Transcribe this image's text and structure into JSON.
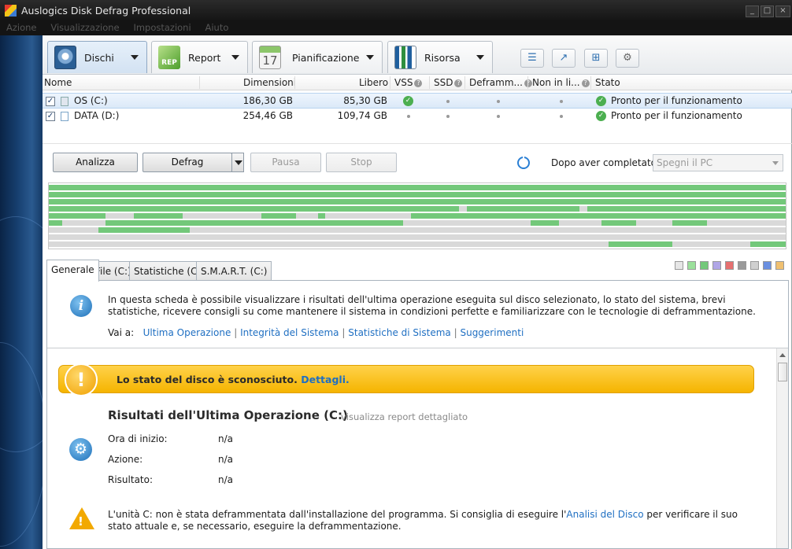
{
  "window": {
    "title": "Auslogics Disk Defrag Professional",
    "controls": [
      "_",
      "□",
      "×"
    ]
  },
  "menu": [
    "Azione",
    "Visualizzazione",
    "Impostazioni",
    "Aiuto"
  ],
  "toolbar": {
    "tabs": [
      {
        "label": "Dischi",
        "icon": "disk-icon"
      },
      {
        "label": "Report",
        "icon": "report-icon"
      },
      {
        "label": "Pianificazione",
        "icon": "calendar-icon",
        "calendar_day": "17"
      },
      {
        "label": "Risorsa",
        "icon": "chart-icon"
      }
    ],
    "icon_buttons": [
      "list-icon",
      "trend-icon",
      "windows-icon",
      "settings-icon"
    ]
  },
  "columns": {
    "nome": "Nome",
    "dimensioni": "Dimensioni",
    "libero": "Libero",
    "vss": "VSS",
    "ssd": "SSD",
    "deframm": "Deframm...",
    "non_in_li": "Non in li...",
    "stato": "Stato"
  },
  "drives": [
    {
      "checked": true,
      "name": "OS (C:)",
      "size": "186,30 GB",
      "free": "85,30 GB",
      "vss": true,
      "status": "Pronto per il funzionamento",
      "selected": true
    },
    {
      "checked": true,
      "name": "DATA (D:)",
      "size": "254,46 GB",
      "free": "109,74 GB",
      "vss": false,
      "status": "Pronto per il funzionamento",
      "selected": false
    }
  ],
  "actions": {
    "analizza": "Analizza",
    "defrag": "Defrag",
    "pausa": "Pausa",
    "stop": "Stop",
    "after_label": "Dopo aver completato:",
    "after_value": "Spegni il PC",
    "after_checked": false
  },
  "cluster_colors": {
    "used": "#73c87a",
    "free": "#d9d9d9"
  },
  "tabs": [
    "Generale",
    "File (C:)",
    "Statistiche (C:)",
    "S.M.A.R.T. (C:)"
  ],
  "legend_colors": [
    "#e6e6e6",
    "#9be09b",
    "#73c87a",
    "#b0a6e6",
    "#e67070",
    "#9a9a9a",
    "#cfcfcf",
    "#6a8fe0",
    "#f0c070"
  ],
  "info": {
    "text": "In questa scheda è possibile visualizzare i risultati dell'ultima operazione eseguita sul disco selezionato, lo stato del sistema, brevi statistiche, ricevere consigli su come mantenere il sistema in condizioni perfette e familiarizzare con le tecnologie di deframmentazione.",
    "vai_label": "Vai a:",
    "links": [
      "Ultima Operazione",
      "Integrità del Sistema",
      "Statistiche di Sistema",
      "Suggerimenti"
    ]
  },
  "warning": {
    "text": "Lo stato del disco è sconosciuto.",
    "link": "Dettagli."
  },
  "results": {
    "title": "Risultati dell'Ultima Operazione (C:)",
    "report_link": "visualizza report dettagliato",
    "rows": [
      {
        "label": "Ora di inizio:",
        "value": "n/a"
      },
      {
        "label": "Azione:",
        "value": "n/a"
      },
      {
        "label": "Risultato:",
        "value": "n/a"
      }
    ]
  },
  "note": {
    "pre": "L'unità C: non è stata deframmentata dall'installazione del programma. Si consiglia di eseguire l'",
    "link": "Analisi del Disco",
    "post": " per verificare il suo stato attuale e, se necessario, eseguire la deframmentazione."
  }
}
